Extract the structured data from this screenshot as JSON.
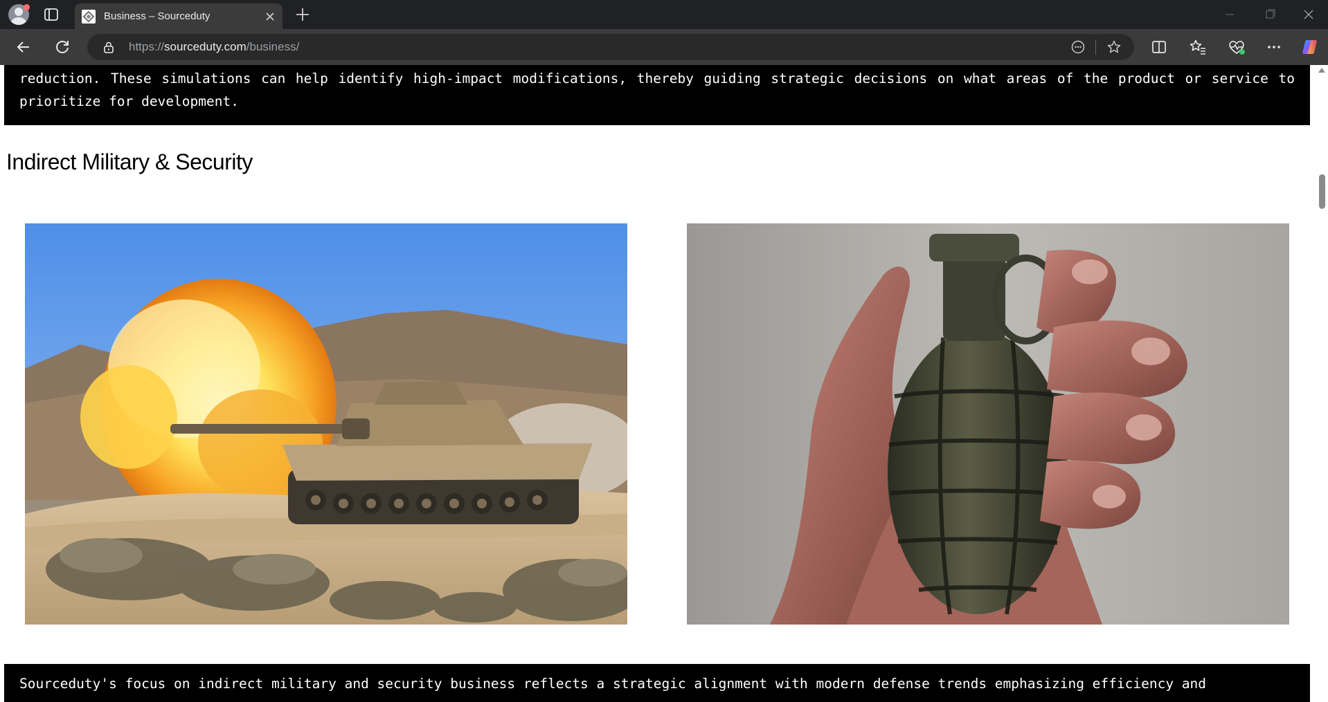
{
  "browser": {
    "tab_title": "Business – Sourceduty",
    "url_prefix": "https://",
    "url_domain": "sourceduty.com",
    "url_path": "/business/"
  },
  "icons": {
    "profile": "profile-avatar-icon",
    "sidebar": "sidebar-toggle-icon",
    "favicon": "site-favicon-icon",
    "close_tab": "close-icon",
    "new_tab": "plus-icon",
    "back": "back-arrow-icon",
    "reload": "reload-icon",
    "lock": "lock-icon",
    "reader": "immersive-reader-icon",
    "favorite": "star-icon",
    "split": "split-screen-icon",
    "favorites_bar": "favorites-icon",
    "health": "browser-essentials-icon",
    "more": "more-icon",
    "copilot": "copilot-icon"
  },
  "page": {
    "top_paragraph": "reduction. These simulations can help identify high-impact modifications, thereby guiding strategic decisions on what areas of the product or service to prioritize for development.",
    "heading": "Indirect Military & Security",
    "bottom_paragraph": "Sourceduty's focus on indirect military and security business reflects a strategic alignment with modern defense trends emphasizing efficiency and",
    "images": [
      {
        "name": "tank-firing-image"
      },
      {
        "name": "hand-grenade-image"
      }
    ]
  },
  "colors": {
    "titlebar": "#202124",
    "toolbar": "#3b3b3b",
    "code_bg": "#000000",
    "code_text": "#ffffff",
    "page_bg": "#ffffff"
  }
}
